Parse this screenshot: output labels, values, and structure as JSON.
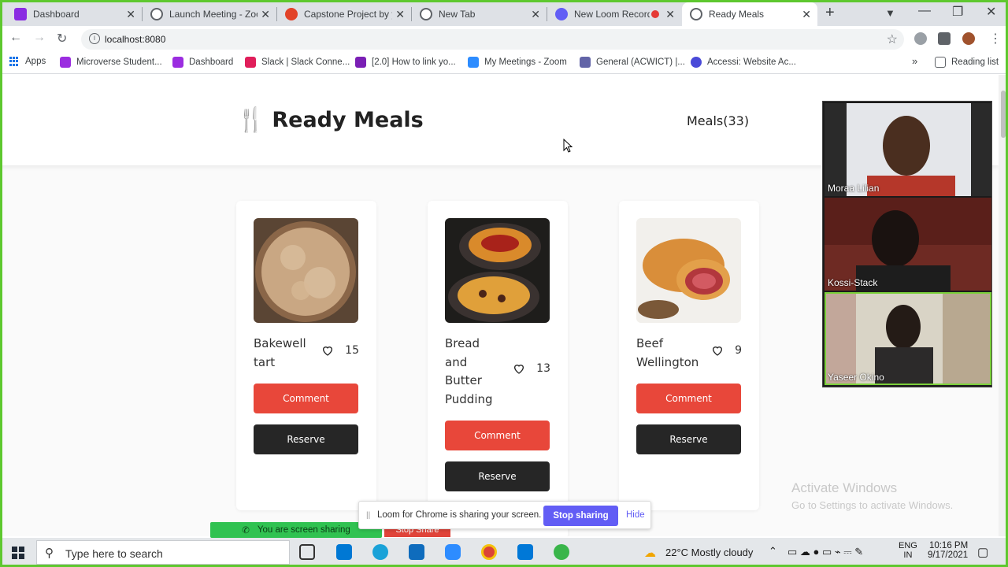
{
  "browser": {
    "tabs": [
      {
        "title": "Dashboard",
        "color": "#8a2be2"
      },
      {
        "title": "Launch Meeting - Zoom",
        "color": "#5f6368"
      },
      {
        "title": "Capstone Project by y",
        "color": "#5f6368"
      },
      {
        "title": "New Tab",
        "color": "#5f6368"
      },
      {
        "title": "New Loom Recording",
        "color": "#625df5"
      },
      {
        "title": "Ready Meals",
        "color": "#5f6368",
        "active": true
      }
    ],
    "url": "localhost:8080",
    "bookmarks": [
      {
        "label": "Apps"
      },
      {
        "label": "Microverse Student...",
        "color": "#9b2de0"
      },
      {
        "label": "Dashboard",
        "color": "#9b2de0"
      },
      {
        "label": "Slack | Slack Conne...",
        "color": "#e01e5a"
      },
      {
        "label": "[2.0] How to link yo...",
        "color": "#7a1fb5"
      },
      {
        "label": "My Meetings - Zoom",
        "color": "#2d8cff"
      },
      {
        "label": "General (ACWICT) |...",
        "color": "#6264a7"
      },
      {
        "label": "Accessi: Website Ac...",
        "color": "#4a4ad8"
      }
    ],
    "reading_list": "Reading list",
    "more": "»"
  },
  "site": {
    "title": "Ready Meals",
    "meals_count": "Meals(33)"
  },
  "meals": [
    {
      "name": "Bakewell tart",
      "likes": "15",
      "comment": "Comment",
      "reserve": "Reserve"
    },
    {
      "name": "Bread and Butter Pudding",
      "likes": "13",
      "comment": "Comment",
      "reserve": "Reserve"
    },
    {
      "name": "Beef Wellington",
      "likes": "9",
      "comment": "Comment",
      "reserve": "Reserve"
    }
  ],
  "activate_windows": {
    "line1": "Activate Windows",
    "line2": "Go to Settings to activate Windows."
  },
  "loom": {
    "message": "Loom for Chrome is sharing your screen.",
    "stop": "Stop sharing",
    "hide": "Hide"
  },
  "zoom": {
    "sharing": "You are screen sharing",
    "stop_share": "Stop Share"
  },
  "participants": [
    {
      "name": "Moraa Lilian"
    },
    {
      "name": "Kossi-Stack"
    },
    {
      "name": "Yaseer Okino"
    }
  ],
  "taskbar": {
    "search_placeholder": "Type here to search",
    "weather": "22°C  Mostly cloudy",
    "lang1": "ENG",
    "lang2": "IN",
    "time": "10:16 PM",
    "date": "9/17/2021"
  }
}
